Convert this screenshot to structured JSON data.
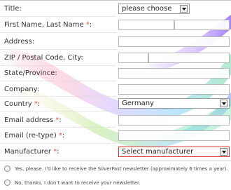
{
  "form": {
    "title": {
      "label": "Title:",
      "select_value": "please choose"
    },
    "name": {
      "label": "First Name, Last Name ",
      "req": "*",
      "colon": ":"
    },
    "address": {
      "label": "Address:"
    },
    "zip": {
      "label": "ZIP / Postal Code, City:"
    },
    "state": {
      "label": "State/Province:"
    },
    "company": {
      "label": "Company:"
    },
    "country": {
      "label": "Country ",
      "req": "*",
      "colon": ":",
      "select_value": "Germany"
    },
    "email": {
      "label": "Email address ",
      "req": "*",
      "colon": ":"
    },
    "email_retype": {
      "label": "Email (re-type) ",
      "req": "*",
      "colon": ":"
    },
    "manufacturer": {
      "label": "Manufacturer ",
      "req": "*",
      "colon": ":",
      "select_value": "Select manufacturer"
    }
  },
  "newsletter": {
    "yes_label": "Yes, please. I'd like to receive the SilverFast newsletter (approximately 6 times a year).",
    "no_label": "No, thanks. I don't want to receive your newsletter."
  },
  "colors": {
    "required": "#d9534f",
    "manufacturer_border": "#e0322e"
  }
}
